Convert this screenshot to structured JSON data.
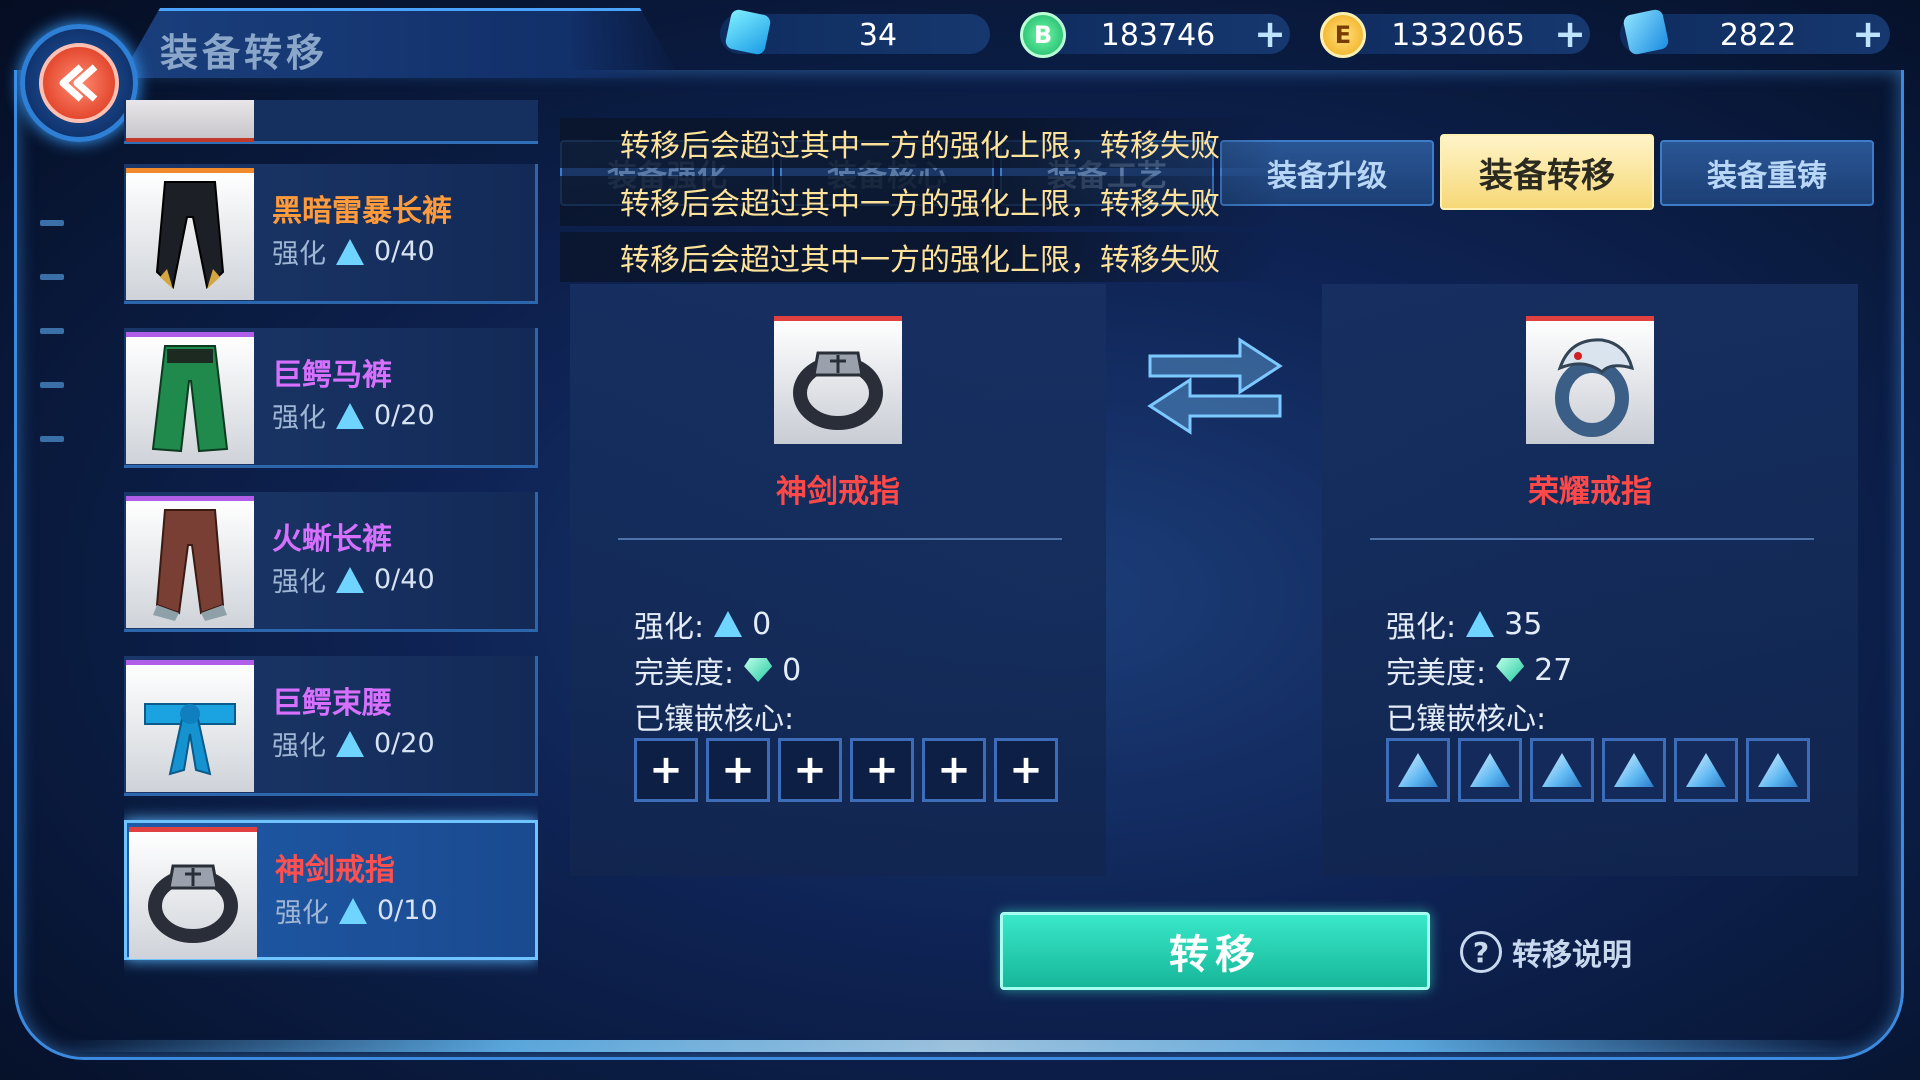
{
  "header": {
    "title": "装备转移",
    "back_icon": "back-arrow-icon"
  },
  "currencies": [
    {
      "icon": "crystal-icon",
      "value": "34",
      "has_plus": false
    },
    {
      "icon": "b-coin-icon",
      "glyph": "B",
      "value": "183746",
      "has_plus": true
    },
    {
      "icon": "e-coin-icon",
      "glyph": "E",
      "value": "1332065",
      "has_plus": true
    },
    {
      "icon": "ticket-icon",
      "value": "2822",
      "has_plus": true
    }
  ],
  "plus_glyph": "+",
  "equipment_list": [
    {
      "name": "黑暗雷暴长裤",
      "stat_label": "强化",
      "stat_value": "0/40",
      "rarity_color": "#ff9b3b",
      "icon": "dark-pants-icon"
    },
    {
      "name": "巨鳄马裤",
      "stat_label": "强化",
      "stat_value": "0/20",
      "rarity_color": "#d770ff",
      "icon": "green-pants-icon"
    },
    {
      "name": "火蜥长裤",
      "stat_label": "强化",
      "stat_value": "0/40",
      "rarity_color": "#d770ff",
      "icon": "brown-pants-icon"
    },
    {
      "name": "巨鳄束腰",
      "stat_label": "强化",
      "stat_value": "0/20",
      "rarity_color": "#d770ff",
      "icon": "blue-sash-icon"
    },
    {
      "name": "神剑戒指",
      "stat_label": "强化",
      "stat_value": "0/10",
      "rarity_color": "#ff5050",
      "icon": "sword-ring-icon",
      "selected": true
    }
  ],
  "tabs": [
    {
      "label": "装备强化",
      "state": "faded"
    },
    {
      "label": "装备核心",
      "state": "faded"
    },
    {
      "label": "装备工艺",
      "state": "faded"
    },
    {
      "label": "装备升级",
      "state": "normal"
    },
    {
      "label": "装备转移",
      "state": "active"
    },
    {
      "label": "装备重铸",
      "state": "normal"
    }
  ],
  "messages": [
    "转移后会超过其中一方的强化上限，转移失败",
    "转移后会超过其中一方的强化上限，转移失败",
    "转移后会超过其中一方的强化上限，转移失败"
  ],
  "source": {
    "name": "神剑戒指",
    "enhance_label": "强化:",
    "enhance_value": "0",
    "perfection_label": "完美度:",
    "perfection_value": "0",
    "cores_label": "已镶嵌核心:",
    "slots": [
      "empty",
      "empty",
      "empty",
      "empty",
      "empty",
      "empty"
    ]
  },
  "target": {
    "name": "荣耀戒指",
    "enhance_label": "强化:",
    "enhance_value": "35",
    "perfection_label": "完美度:",
    "perfection_value": "27",
    "cores_label": "已镶嵌核心:",
    "slots": [
      "core",
      "core",
      "core",
      "core",
      "core",
      "core"
    ]
  },
  "actions": {
    "transfer_label": "转移",
    "help_icon_glyph": "?",
    "help_label": "转移说明"
  },
  "colors": {
    "accent": "#3c8ae0",
    "active_tab": "#f6d877",
    "transfer_button": "#17b699",
    "item_name_red": "#ff4848",
    "message_text": "#ffe39a"
  }
}
